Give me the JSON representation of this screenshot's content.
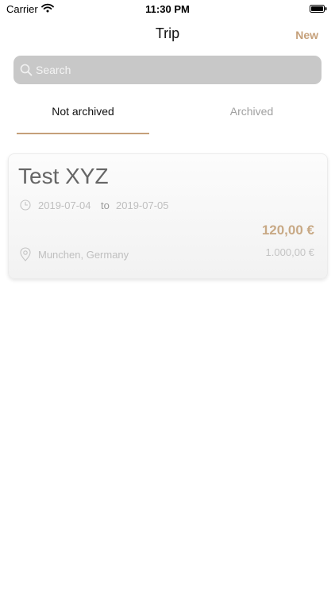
{
  "status_bar": {
    "carrier": "Carrier",
    "time": "11:30 PM"
  },
  "nav": {
    "title": "Trip",
    "new_label": "New"
  },
  "search": {
    "placeholder": "Search",
    "value": ""
  },
  "tabs": [
    {
      "label": "Not archived",
      "selected": true
    },
    {
      "label": "Archived",
      "selected": false
    }
  ],
  "trips": [
    {
      "title": "Test XYZ",
      "date_from": "2019-07-04",
      "date_separator": "to",
      "date_to": "2019-07-05",
      "amount": "120,00 €",
      "budget": "1.000,00 €",
      "location": "Munchen, Germany"
    }
  ],
  "colors": {
    "accent": "#c5a07a",
    "search_bg": "#c8c8c8",
    "muted_text": "#bfbfbf"
  },
  "icons": {
    "signal": "wifi-icon",
    "battery": "battery-icon",
    "search": "search-icon",
    "date": "clock-icon",
    "location": "map-pin-icon"
  }
}
